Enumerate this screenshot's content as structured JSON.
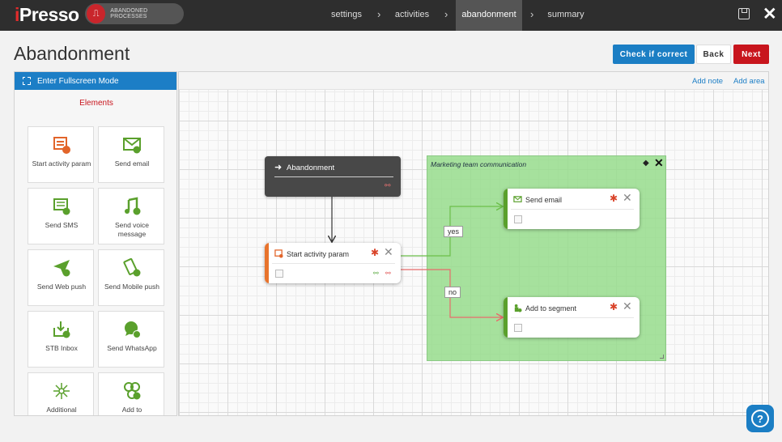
{
  "topbar": {
    "logo": "iPresso",
    "process_type": "ABANDONED PROCESSES",
    "steps": [
      {
        "label": "settings"
      },
      {
        "label": "activities"
      },
      {
        "label": "abandonment"
      },
      {
        "label": "summary"
      }
    ],
    "active_step": "abandonment"
  },
  "header": {
    "title": "Abandonment",
    "check_label": "Check if correct",
    "back_label": "Back",
    "next_label": "Next"
  },
  "sidebar": {
    "fullscreen_label": "Enter Fullscreen Mode",
    "elements_title": "Elements",
    "tiles": [
      {
        "label": "Start activity param",
        "icon": "activity-param-icon"
      },
      {
        "label": "Send email",
        "icon": "email-icon"
      },
      {
        "label": "Send SMS",
        "icon": "sms-icon"
      },
      {
        "label": "Send voice message",
        "icon": "voice-icon"
      },
      {
        "label": "Send Web push",
        "icon": "web-push-icon"
      },
      {
        "label": "Send Mobile push",
        "icon": "mobile-push-icon"
      },
      {
        "label": "STB Inbox",
        "icon": "inbox-icon"
      },
      {
        "label": "Send WhatsApp",
        "icon": "whatsapp-icon"
      },
      {
        "label": "Additional",
        "icon": "additional-icon"
      },
      {
        "label": "Add to",
        "icon": "add-to-icon"
      }
    ]
  },
  "canvas": {
    "add_note_label": "Add note",
    "add_area_label": "Add area",
    "area_title": "Marketing team communication",
    "nodes": {
      "abandonment": "Abandonment",
      "start_param": "Start activity param",
      "send_email": "Send email",
      "add_segment": "Add to segment"
    },
    "yes_label": "yes",
    "no_label": "no"
  },
  "colors": {
    "topbar": "#2e2e2e",
    "accent_blue": "#1c7ec6",
    "accent_red": "#c8151d",
    "icon_green": "#5aa02c",
    "area_green": "#96dc8c"
  }
}
